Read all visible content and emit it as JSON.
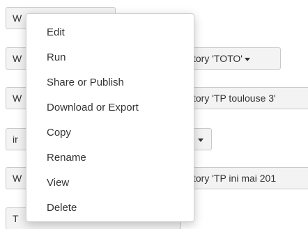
{
  "background_buttons": [
    {
      "lead": "W",
      "tail": ""
    },
    {
      "lead": "W",
      "tail": "tory 'TOTO'"
    },
    {
      "lead": "W",
      "tail": "tory 'TP toulouse 3'"
    },
    {
      "lead": "ir",
      "tail": ""
    },
    {
      "lead": "W",
      "tail": "tory 'TP ini mai 201"
    },
    {
      "lead": "T",
      "tail": ""
    }
  ],
  "menu": {
    "items": [
      {
        "label": "Edit"
      },
      {
        "label": "Run"
      },
      {
        "label": "Share or Publish"
      },
      {
        "label": "Download or Export"
      },
      {
        "label": "Copy"
      },
      {
        "label": "Rename"
      },
      {
        "label": "View"
      },
      {
        "label": "Delete"
      }
    ]
  }
}
